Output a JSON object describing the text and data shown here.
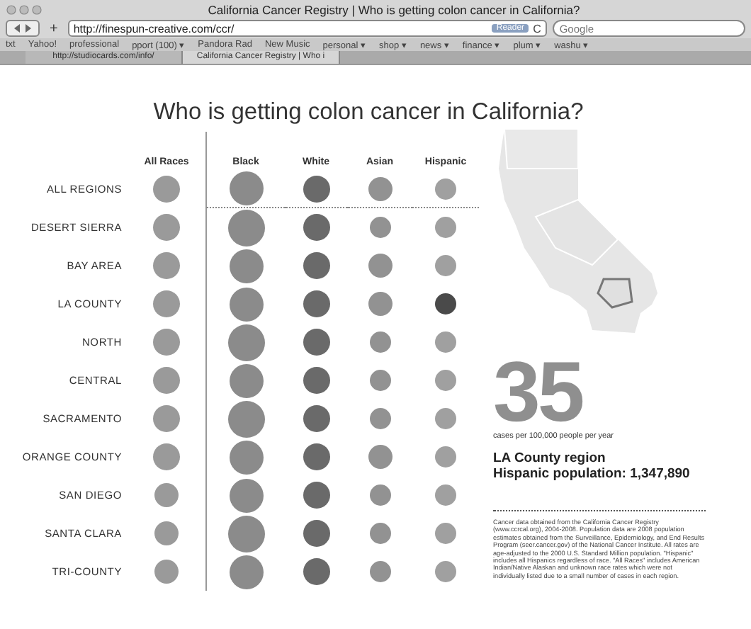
{
  "window": {
    "title": "California Cancer Registry | Who is getting colon cancer in California?"
  },
  "toolbar": {
    "add_label": "+",
    "url": "http://finespun-creative.com/ccr/",
    "reader_label": "Reader",
    "reload_label": "C",
    "search_placeholder": "Google"
  },
  "bookmarks": [
    "txt",
    "Yahoo!",
    "professional",
    "pport (100) ▾",
    "Pandora Rad",
    "New Music",
    "personal ▾",
    "shop ▾",
    "news ▾",
    "finance ▾",
    "plum ▾",
    "washu ▾"
  ],
  "tabs": [
    {
      "label": "http://studiocards.com/info/",
      "selected": false
    },
    {
      "label": "California Cancer Registry | Who i",
      "selected": true
    }
  ],
  "page": {
    "heading": "Who is getting colon cancer in California?",
    "columns": [
      {
        "label": "All Races",
        "color": "#9a9a9a"
      },
      {
        "label": "Black",
        "color": "#8b8b8b"
      },
      {
        "label": "White",
        "color": "#6a6a6a"
      },
      {
        "label": "Asian",
        "color": "#929292"
      },
      {
        "label": "Hispanic",
        "color": "#a0a0a0"
      }
    ],
    "rows": [
      {
        "region": "ALL REGIONS",
        "dots": [
          {
            "kind": "medium",
            "selected": false
          },
          {
            "kind": "large",
            "selected": false
          },
          {
            "kind": "medium",
            "selected": false
          },
          {
            "kind": "small",
            "selected": false
          },
          {
            "kind": "tiny",
            "selected": false
          }
        ]
      },
      {
        "region": "DESERT SIERRA",
        "dots": [
          {
            "kind": "medium",
            "selected": false
          },
          {
            "kind": "huge",
            "selected": false
          },
          {
            "kind": "medium",
            "selected": false
          },
          {
            "kind": "tiny",
            "selected": false
          },
          {
            "kind": "tiny",
            "selected": false
          }
        ]
      },
      {
        "region": "BAY AREA",
        "dots": [
          {
            "kind": "medium",
            "selected": false
          },
          {
            "kind": "large",
            "selected": false
          },
          {
            "kind": "medium",
            "selected": false
          },
          {
            "kind": "small",
            "selected": false
          },
          {
            "kind": "tiny",
            "selected": false
          }
        ]
      },
      {
        "region": "LA COUNTY",
        "dots": [
          {
            "kind": "medium",
            "selected": false
          },
          {
            "kind": "large",
            "selected": false
          },
          {
            "kind": "medium",
            "selected": false
          },
          {
            "kind": "small",
            "selected": false
          },
          {
            "kind": "tiny",
            "selected": true
          }
        ]
      },
      {
        "region": "NORTH",
        "dots": [
          {
            "kind": "medium",
            "selected": false
          },
          {
            "kind": "huge",
            "selected": false
          },
          {
            "kind": "medium",
            "selected": false
          },
          {
            "kind": "tiny",
            "selected": false
          },
          {
            "kind": "tiny",
            "selected": false
          }
        ]
      },
      {
        "region": "CENTRAL",
        "dots": [
          {
            "kind": "medium",
            "selected": false
          },
          {
            "kind": "large",
            "selected": false
          },
          {
            "kind": "medium",
            "selected": false
          },
          {
            "kind": "tiny",
            "selected": false
          },
          {
            "kind": "tiny",
            "selected": false
          }
        ]
      },
      {
        "region": "SACRAMENTO",
        "dots": [
          {
            "kind": "medium",
            "selected": false
          },
          {
            "kind": "huge",
            "selected": false
          },
          {
            "kind": "medium",
            "selected": false
          },
          {
            "kind": "tiny",
            "selected": false
          },
          {
            "kind": "tiny",
            "selected": false
          }
        ]
      },
      {
        "region": "ORANGE COUNTY",
        "dots": [
          {
            "kind": "medium",
            "selected": false
          },
          {
            "kind": "large",
            "selected": false
          },
          {
            "kind": "medium",
            "selected": false
          },
          {
            "kind": "small",
            "selected": false
          },
          {
            "kind": "tiny",
            "selected": false
          }
        ]
      },
      {
        "region": "SAN DIEGO",
        "dots": [
          {
            "kind": "small",
            "selected": false
          },
          {
            "kind": "large",
            "selected": false
          },
          {
            "kind": "medium",
            "selected": false
          },
          {
            "kind": "tiny",
            "selected": false
          },
          {
            "kind": "tiny",
            "selected": false
          }
        ]
      },
      {
        "region": "SANTA CLARA",
        "dots": [
          {
            "kind": "small",
            "selected": false
          },
          {
            "kind": "huge",
            "selected": false
          },
          {
            "kind": "medium",
            "selected": false
          },
          {
            "kind": "tiny",
            "selected": false
          },
          {
            "kind": "tiny",
            "selected": false
          }
        ]
      },
      {
        "region": "TRI-COUNTY",
        "dots": [
          {
            "kind": "small",
            "selected": false
          },
          {
            "kind": "large",
            "selected": false
          },
          {
            "kind": "medium",
            "selected": false
          },
          {
            "kind": "tiny",
            "selected": false
          },
          {
            "kind": "tiny",
            "selected": false
          }
        ]
      }
    ],
    "detail": {
      "rate": "35",
      "rate_caption": "cases per 100,000 people per year",
      "region": "LA County region",
      "population": "Hispanic population: 1,347,890",
      "footnote": "Cancer data obtained from the California Cancer Registry (www.ccrcal.org), 2004-2008. Population data are 2008 population estimates obtained from the Surveillance, Epidemiology, and End Results Program (seer.cancer.gov) of the National Cancer Institute. All rates are age-adjusted to the 2000 U.S. Standard Million population. \"Hispanic\" includes all Hispanics regardless of race. \"All Races\" includes American Indian/Native Alaskan and unknown race rates which were not individually listed due to a small number of cases in each region."
    }
  }
}
